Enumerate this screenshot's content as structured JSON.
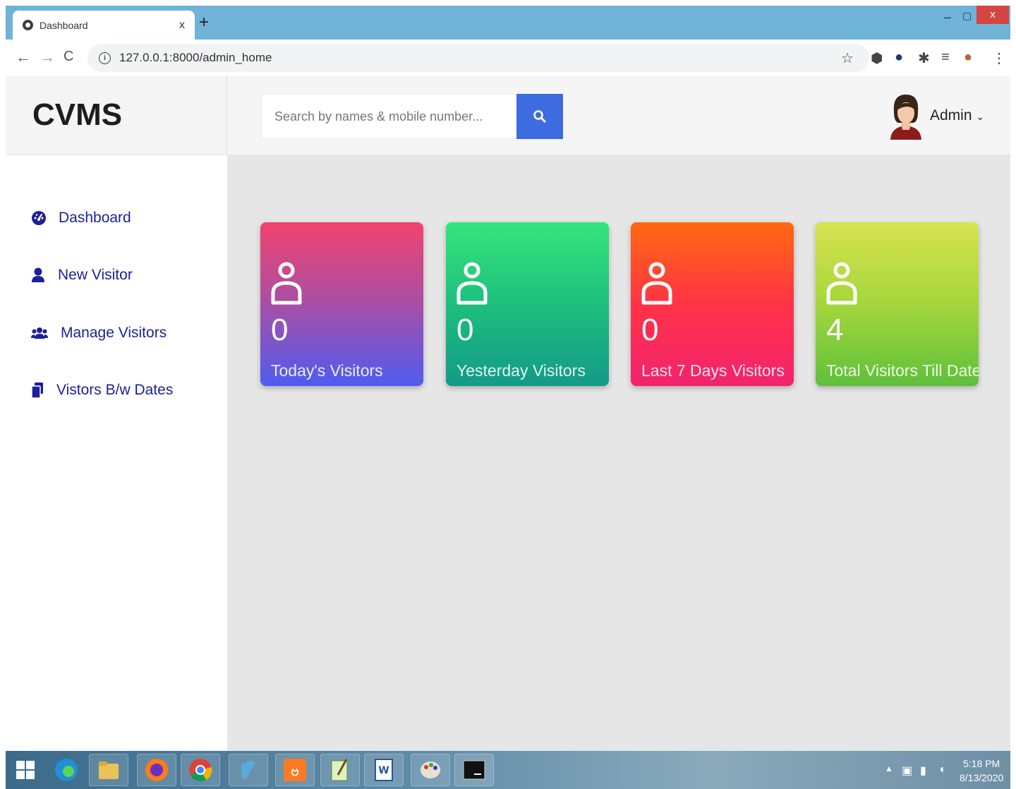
{
  "browser": {
    "tab_title": "Dashboard",
    "tab_close": "x",
    "new_tab": "+",
    "url": "127.0.0.1:8000/admin_home",
    "window_controls": {
      "minimize": "‒",
      "maximize": "▢",
      "close": "x"
    }
  },
  "header": {
    "brand": "CVMS",
    "search_placeholder": "Search by names & mobile number...",
    "user_label": "Admin",
    "user_caret": "⌄"
  },
  "sidebar": {
    "items": [
      {
        "label": "Dashboard",
        "icon": "dashboard-gauge-icon"
      },
      {
        "label": "New Visitor",
        "icon": "user-icon"
      },
      {
        "label": "Manage Visitors",
        "icon": "users-icon"
      },
      {
        "label": "Vistors B/w Dates",
        "icon": "files-icon"
      }
    ]
  },
  "stats": [
    {
      "value": "0",
      "label": "Today's Visitors"
    },
    {
      "value": "0",
      "label": "Yesterday Visitors"
    },
    {
      "value": "0",
      "label": "Last 7 Days Visitors"
    },
    {
      "value": "4",
      "label": "Total Visitors Till Date"
    }
  ],
  "taskbar": {
    "time": "5:18 PM",
    "date": "8/13/2020",
    "apps": [
      "windows-start",
      "edge",
      "file-explorer",
      "firefox",
      "chrome",
      "app-cube",
      "xampp",
      "notepad-plus",
      "word",
      "paint",
      "command-prompt"
    ]
  },
  "colors": {
    "brand_blue": "#3d6be0",
    "sidebar_text": "#1b1f9a",
    "card1": "#f2436d",
    "card2": "#35e57b",
    "card3": "#ff6a10",
    "card4": "#d8e24f"
  }
}
